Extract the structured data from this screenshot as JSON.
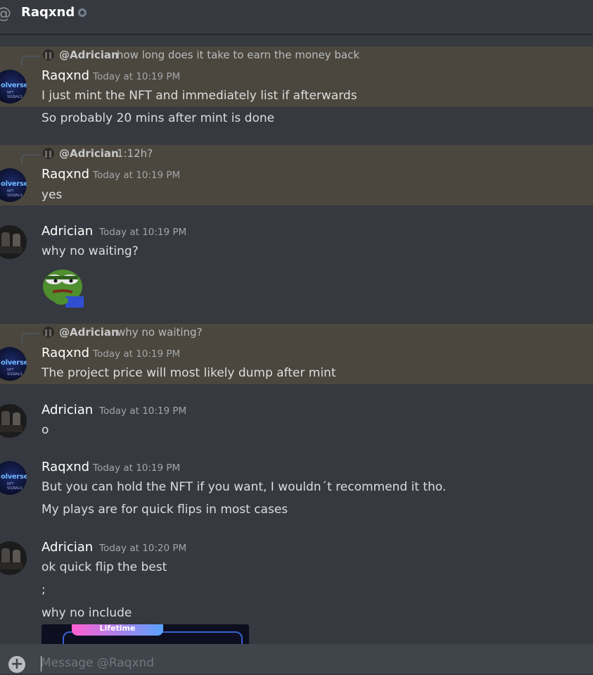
{
  "header": {
    "title": "Raqxnd"
  },
  "avatar_text": {
    "title": "olverse",
    "subtitle": "NFT SIGNALS"
  },
  "messages": [
    {
      "reply_to": "@Adrician",
      "reply_text": "how long does it take to earn the money back",
      "author": "Raqxnd",
      "time": "Today at 10:19 PM",
      "lines": [
        "I just mint the NFT and immediately list if afterwards",
        "So probably 20 mins after mint is done"
      ]
    },
    {
      "reply_to": "@Adrician",
      "reply_text": "1:12h?",
      "author": "Raqxnd",
      "time": "Today at 10:19 PM",
      "lines": [
        "yes"
      ]
    },
    {
      "author": "Adrician",
      "time": "Today at 10:19 PM",
      "lines": [
        "why no waiting?"
      ],
      "sticker": "pepe-sticker"
    },
    {
      "reply_to": "@Adrician",
      "reply_text": "why no waiting?",
      "author": "Raqxnd",
      "time": "Today at 10:19 PM",
      "lines": [
        "The project price will most likely dump after mint"
      ]
    },
    {
      "author": "Adrician",
      "time": "Today at 10:19 PM",
      "lines": [
        "o"
      ]
    },
    {
      "author": "Raqxnd",
      "time": "Today at 10:19 PM",
      "lines": [
        "But you can hold the NFT if you want, I wouldn´t recommend it tho.",
        "My plays are for quick flips in most cases"
      ]
    },
    {
      "author": "Adrician",
      "time": "Today at 10:20 PM",
      "lines": [
        "ok quick flip the best",
        ";",
        "why no include"
      ],
      "embed_label": "Lifetime"
    }
  ],
  "composer": {
    "placeholder": "Message @Raqxnd"
  },
  "colors": {
    "highlight": "#4b473e",
    "background": "#36393f",
    "composer": "#40444b"
  }
}
